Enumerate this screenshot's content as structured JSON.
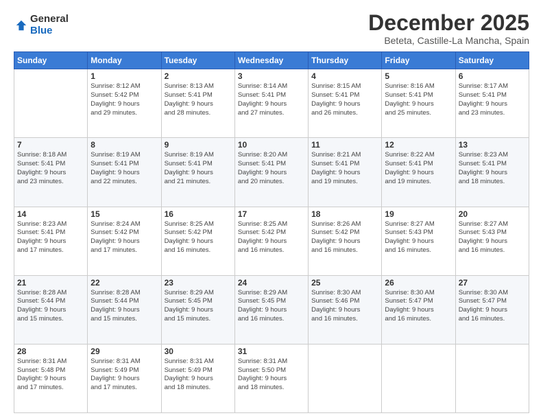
{
  "logo": {
    "general": "General",
    "blue": "Blue"
  },
  "header": {
    "month": "December 2025",
    "location": "Beteta, Castille-La Mancha, Spain"
  },
  "days": [
    "Sunday",
    "Monday",
    "Tuesday",
    "Wednesday",
    "Thursday",
    "Friday",
    "Saturday"
  ],
  "weeks": [
    [
      {
        "day": "",
        "info": ""
      },
      {
        "day": "1",
        "info": "Sunrise: 8:12 AM\nSunset: 5:42 PM\nDaylight: 9 hours\nand 29 minutes."
      },
      {
        "day": "2",
        "info": "Sunrise: 8:13 AM\nSunset: 5:41 PM\nDaylight: 9 hours\nand 28 minutes."
      },
      {
        "day": "3",
        "info": "Sunrise: 8:14 AM\nSunset: 5:41 PM\nDaylight: 9 hours\nand 27 minutes."
      },
      {
        "day": "4",
        "info": "Sunrise: 8:15 AM\nSunset: 5:41 PM\nDaylight: 9 hours\nand 26 minutes."
      },
      {
        "day": "5",
        "info": "Sunrise: 8:16 AM\nSunset: 5:41 PM\nDaylight: 9 hours\nand 25 minutes."
      },
      {
        "day": "6",
        "info": "Sunrise: 8:17 AM\nSunset: 5:41 PM\nDaylight: 9 hours\nand 23 minutes."
      }
    ],
    [
      {
        "day": "7",
        "info": "Sunrise: 8:18 AM\nSunset: 5:41 PM\nDaylight: 9 hours\nand 23 minutes."
      },
      {
        "day": "8",
        "info": "Sunrise: 8:19 AM\nSunset: 5:41 PM\nDaylight: 9 hours\nand 22 minutes."
      },
      {
        "day": "9",
        "info": "Sunrise: 8:19 AM\nSunset: 5:41 PM\nDaylight: 9 hours\nand 21 minutes."
      },
      {
        "day": "10",
        "info": "Sunrise: 8:20 AM\nSunset: 5:41 PM\nDaylight: 9 hours\nand 20 minutes."
      },
      {
        "day": "11",
        "info": "Sunrise: 8:21 AM\nSunset: 5:41 PM\nDaylight: 9 hours\nand 19 minutes."
      },
      {
        "day": "12",
        "info": "Sunrise: 8:22 AM\nSunset: 5:41 PM\nDaylight: 9 hours\nand 19 minutes."
      },
      {
        "day": "13",
        "info": "Sunrise: 8:23 AM\nSunset: 5:41 PM\nDaylight: 9 hours\nand 18 minutes."
      }
    ],
    [
      {
        "day": "14",
        "info": "Sunrise: 8:23 AM\nSunset: 5:41 PM\nDaylight: 9 hours\nand 17 minutes."
      },
      {
        "day": "15",
        "info": "Sunrise: 8:24 AM\nSunset: 5:42 PM\nDaylight: 9 hours\nand 17 minutes."
      },
      {
        "day": "16",
        "info": "Sunrise: 8:25 AM\nSunset: 5:42 PM\nDaylight: 9 hours\nand 16 minutes."
      },
      {
        "day": "17",
        "info": "Sunrise: 8:25 AM\nSunset: 5:42 PM\nDaylight: 9 hours\nand 16 minutes."
      },
      {
        "day": "18",
        "info": "Sunrise: 8:26 AM\nSunset: 5:42 PM\nDaylight: 9 hours\nand 16 minutes."
      },
      {
        "day": "19",
        "info": "Sunrise: 8:27 AM\nSunset: 5:43 PM\nDaylight: 9 hours\nand 16 minutes."
      },
      {
        "day": "20",
        "info": "Sunrise: 8:27 AM\nSunset: 5:43 PM\nDaylight: 9 hours\nand 16 minutes."
      }
    ],
    [
      {
        "day": "21",
        "info": "Sunrise: 8:28 AM\nSunset: 5:44 PM\nDaylight: 9 hours\nand 15 minutes."
      },
      {
        "day": "22",
        "info": "Sunrise: 8:28 AM\nSunset: 5:44 PM\nDaylight: 9 hours\nand 15 minutes."
      },
      {
        "day": "23",
        "info": "Sunrise: 8:29 AM\nSunset: 5:45 PM\nDaylight: 9 hours\nand 15 minutes."
      },
      {
        "day": "24",
        "info": "Sunrise: 8:29 AM\nSunset: 5:45 PM\nDaylight: 9 hours\nand 16 minutes."
      },
      {
        "day": "25",
        "info": "Sunrise: 8:30 AM\nSunset: 5:46 PM\nDaylight: 9 hours\nand 16 minutes."
      },
      {
        "day": "26",
        "info": "Sunrise: 8:30 AM\nSunset: 5:47 PM\nDaylight: 9 hours\nand 16 minutes."
      },
      {
        "day": "27",
        "info": "Sunrise: 8:30 AM\nSunset: 5:47 PM\nDaylight: 9 hours\nand 16 minutes."
      }
    ],
    [
      {
        "day": "28",
        "info": "Sunrise: 8:31 AM\nSunset: 5:48 PM\nDaylight: 9 hours\nand 17 minutes."
      },
      {
        "day": "29",
        "info": "Sunrise: 8:31 AM\nSunset: 5:49 PM\nDaylight: 9 hours\nand 17 minutes."
      },
      {
        "day": "30",
        "info": "Sunrise: 8:31 AM\nSunset: 5:49 PM\nDaylight: 9 hours\nand 18 minutes."
      },
      {
        "day": "31",
        "info": "Sunrise: 8:31 AM\nSunset: 5:50 PM\nDaylight: 9 hours\nand 18 minutes."
      },
      {
        "day": "",
        "info": ""
      },
      {
        "day": "",
        "info": ""
      },
      {
        "day": "",
        "info": ""
      }
    ]
  ]
}
